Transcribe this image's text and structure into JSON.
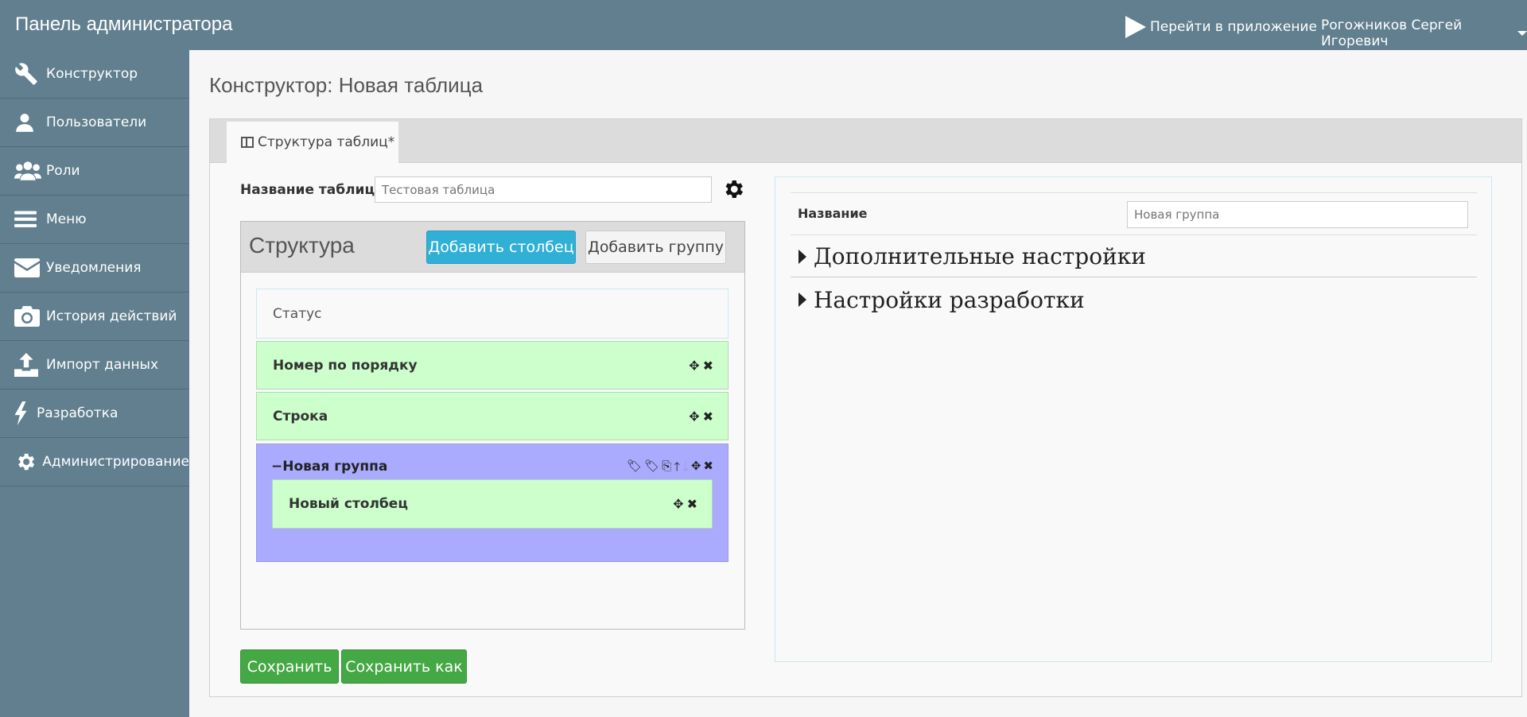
{
  "header": {
    "brand": "Панель администратора",
    "goto_app": "Перейти в приложение",
    "user": "Рогожников Сергей Игоревич"
  },
  "sidebar": {
    "items": [
      {
        "label": "Конструктор",
        "icon": "wrench-icon"
      },
      {
        "label": "Пользователи",
        "icon": "user-icon"
      },
      {
        "label": "Роли",
        "icon": "users-icon"
      },
      {
        "label": "Меню",
        "icon": "menu-icon"
      },
      {
        "label": "Уведомления",
        "icon": "envelope-icon"
      },
      {
        "label": "История действий",
        "icon": "camera-icon"
      },
      {
        "label": "Импорт данных",
        "icon": "upload-icon"
      },
      {
        "label": "Разработка",
        "icon": "bolt-icon"
      },
      {
        "label": "Администрирование",
        "icon": "gear-icon"
      }
    ]
  },
  "main": {
    "title": "Конструктор: Новая таблица",
    "tab": "Структура таблиц*",
    "table_name_label": "Название таблицы",
    "table_name_placeholder": "Тестовая таблица",
    "structure": {
      "title": "Структура",
      "add_column": "Добавить столбец",
      "add_group": "Добавить группу",
      "rows": [
        {
          "label": "Статус"
        },
        {
          "label": "Номер по порядку"
        },
        {
          "label": "Строка"
        }
      ],
      "group": {
        "title": "Новая группа",
        "columns": [
          {
            "label": "Новый столбец"
          }
        ]
      }
    },
    "save": "Сохранить",
    "save_as": "Сохранить как"
  },
  "props": {
    "name_label": "Название",
    "name_placeholder": "Новая группа",
    "sections": [
      "Дополнительные настройки",
      "Настройки разработки"
    ]
  },
  "colors": {
    "sidebar": "#617f8e",
    "row_green": "#ccffcc",
    "group_purple": "#aaaaff",
    "info_button": "#31b0d5",
    "success_button": "#44a844"
  }
}
